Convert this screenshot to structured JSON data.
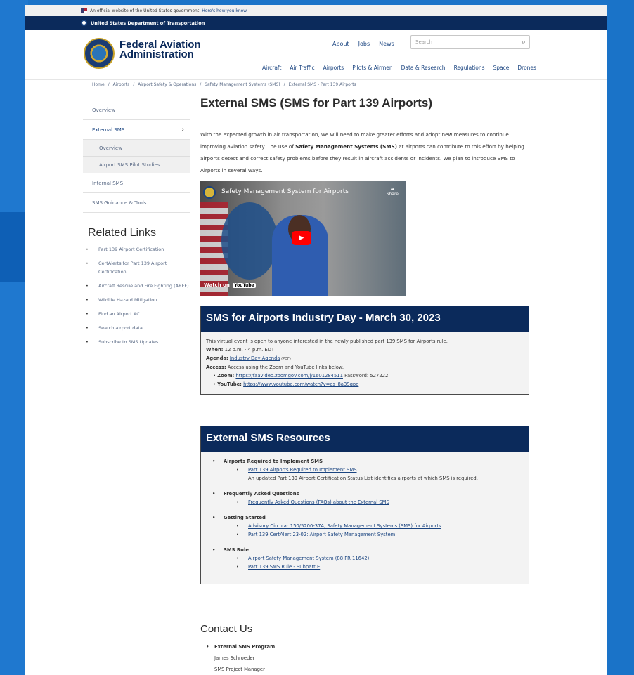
{
  "gov_banner": {
    "text": "An official website of the United States government",
    "link": "Here's how you know"
  },
  "agency_bar": {
    "label": "United States Department of Transportation"
  },
  "header": {
    "logo_line1": "Federal Aviation",
    "logo_line2": "Administration",
    "utility_nav": [
      "About",
      "Jobs",
      "News"
    ],
    "search_placeholder": "Search",
    "main_nav": [
      "Aircraft",
      "Air Traffic",
      "Airports",
      "Pilots & Airmen",
      "Data & Research",
      "Regulations",
      "Space",
      "Drones"
    ]
  },
  "breadcrumb": [
    "Home",
    "/",
    "Airports",
    "/",
    "Airport Safety & Operations",
    "/",
    "Safety Management Systems (SMS)",
    "/",
    "External SMS - Part 139 Airports"
  ],
  "sidebar": {
    "items": [
      {
        "label": "Overview"
      },
      {
        "label": "External SMS",
        "chevron": "›"
      },
      {
        "label": "Overview"
      },
      {
        "label": "Airport SMS Pilot Studies"
      },
      {
        "label": "Internal SMS"
      },
      {
        "label": "SMS Guidance & Tools"
      }
    ]
  },
  "related": {
    "title": "Related Links",
    "links": [
      "Part 139 Airport Certification",
      "CertAlerts for Part 139 Airport Certification",
      "Aircraft Rescue and Fire Fighting (ARFF)",
      "Wildlife Hazard Mitigation",
      "Find an Airport AC",
      "Search airport data",
      "Subscribe to SMS Updates"
    ]
  },
  "main": {
    "title": "External SMS (SMS for Part 139 Airports)",
    "intro_a": "With the expected growth in air transportation, we will need to make greater efforts and adopt new measures to continue improving aviation safety. The use of ",
    "intro_bold": "Safety Management Systems (SMS)",
    "intro_b": " at airports can contribute to this effort by helping airports detect and correct safety problems before they result in aircraft accidents or incidents. We plan to introduce SMS to Airports in several ways."
  },
  "video": {
    "title": "Safety Management System for Airports",
    "share": "Share",
    "watch_on": "Watch on",
    "youtube": "YouTube"
  },
  "industry_day": {
    "heading": "SMS for Airports Industry Day - March 30, 2023",
    "desc": "This virtual event is open to anyone interested in the newly published part 139 SMS for Airports rule.",
    "when_label": "When:",
    "when_value": " 12 p.m. - 4 p.m. EDT",
    "agenda_label": "Agenda:",
    "agenda_link": "Industry Day Agenda",
    "agenda_tag": " (PDF)",
    "access_label": "Access:",
    "access_value": " Access using the Zoom and YouTube links below.",
    "zoom_label": "Zoom:",
    "zoom_link": "https://faavideo.zoomgov.com/j/1601284511",
    "zoom_pw": " Password: 527222",
    "yt_label": "YouTube:",
    "yt_link": "https://www.youtube.com/watch?v=es_8a3Sgpo"
  },
  "resources": {
    "heading": "External SMS Resources",
    "groups": [
      {
        "title": "Airports Required to Implement SMS",
        "links": [
          "Part 139 Airports Required to Implement SMS"
        ],
        "note": "An updated Part 139 Airport Certification Status List identifies airports at which SMS is required."
      },
      {
        "title": "Frequently Asked Questions",
        "links": [
          "Frequently Asked Questions (FAQs) about the External SMS"
        ]
      },
      {
        "title": "Getting Started",
        "links": [
          "Advisory Circular 150/5200-37A, Safety Management Systems (SMS) for Airports",
          "Part 139 CertAlert 23-02: Airport Safety Management System"
        ]
      },
      {
        "title": "SMS Rule",
        "links": [
          "Airport Safety Management System (88 FR 11642)",
          "Part 139 SMS Rule - Subpart E"
        ]
      }
    ]
  },
  "contact": {
    "title": "Contact Us",
    "program": "External SMS Program",
    "name": "James Schroeder",
    "role": "SMS Project Manager"
  }
}
